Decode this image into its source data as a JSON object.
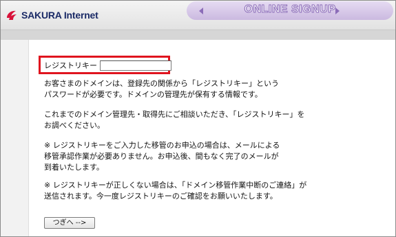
{
  "header": {
    "logo_text": "SAKURA Internet",
    "banner_text": "ONLINE SIGNUP"
  },
  "form": {
    "registry_label": "レジストリキー",
    "registry_value": ""
  },
  "paragraphs": {
    "p1_line1": "お客さまのドメインは、登録先の関係から「レジストリキー」という",
    "p1_line2": "パスワードが必要です。ドメインの管理先が保有する情報です。",
    "p2_line1": "これまでのドメイン管理先・取得先にご相談いただき、「レジストリキー」を",
    "p2_line2": "お調べください。",
    "p3_line1": "※ レジストリキーをご入力した移管のお申込の場合は、メールによる",
    "p3_line2": "移管承認作業が必要ありません。お申込後、間もなく完了のメールが",
    "p3_line3": "到着いたします。",
    "p4_line1": "※ レジストリキーが正しくない場合は、「ドメイン移管作業中断のご連絡」が",
    "p4_line2": "送信されます。今一度レジストリキーのご確認をお願いいたします。"
  },
  "buttons": {
    "next_label": "つぎへ -->"
  },
  "colors": {
    "highlight": "#e0141e",
    "banner": "#cbb9e0",
    "logo": "#1a2a66"
  }
}
